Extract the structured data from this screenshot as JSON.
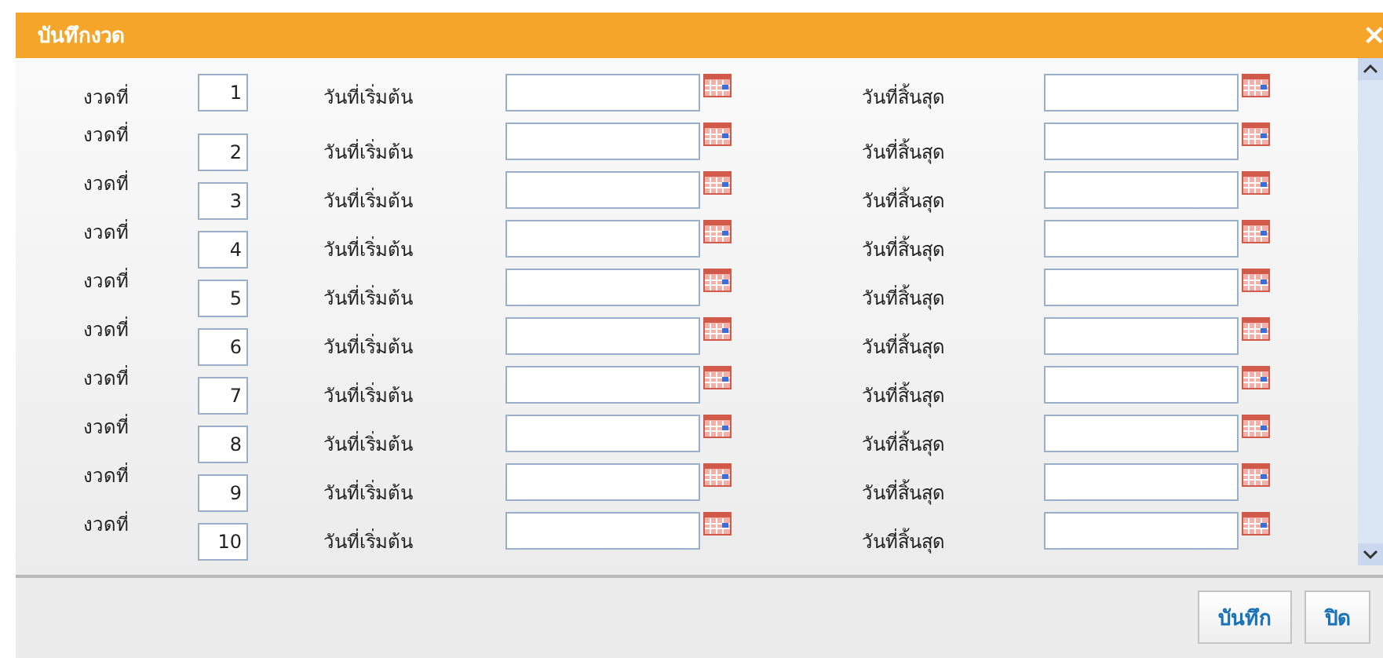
{
  "dialog": {
    "title": "บันทึกงวด",
    "close_glyph": "×"
  },
  "rows": [
    {
      "label": "งวดที่",
      "number": "1",
      "start_label": "วันที่เริ่มต้น",
      "end_label": "วันที่สิ้นสุด"
    },
    {
      "label": "งวดที่",
      "number": "2",
      "start_label": "วันที่เริ่มต้น",
      "end_label": "วันที่สิ้นสุด"
    },
    {
      "label": "งวดที่",
      "number": "3",
      "start_label": "วันที่เริ่มต้น",
      "end_label": "วันที่สิ้นสุด"
    },
    {
      "label": "งวดที่",
      "number": "4",
      "start_label": "วันที่เริ่มต้น",
      "end_label": "วันที่สิ้นสุด"
    },
    {
      "label": "งวดที่",
      "number": "5",
      "start_label": "วันที่เริ่มต้น",
      "end_label": "วันที่สิ้นสุด"
    },
    {
      "label": "งวดที่",
      "number": "6",
      "start_label": "วันที่เริ่มต้น",
      "end_label": "วันที่สิ้นสุด"
    },
    {
      "label": "งวดที่",
      "number": "7",
      "start_label": "วันที่เริ่มต้น",
      "end_label": "วันที่สิ้นสุด"
    },
    {
      "label": "งวดที่",
      "number": "8",
      "start_label": "วันที่เริ่มต้น",
      "end_label": "วันที่สิ้นสุด"
    },
    {
      "label": "งวดที่",
      "number": "9",
      "start_label": "วันที่เริ่มต้น",
      "end_label": "วันที่สิ้นสุด"
    },
    {
      "label": "งวดที่",
      "number": "10",
      "start_label": "วันที่เริ่มต้น",
      "end_label": "วันที่สิ้นสุด"
    }
  ],
  "buttons": [
    "บันทึก",
    "ปิด"
  ]
}
